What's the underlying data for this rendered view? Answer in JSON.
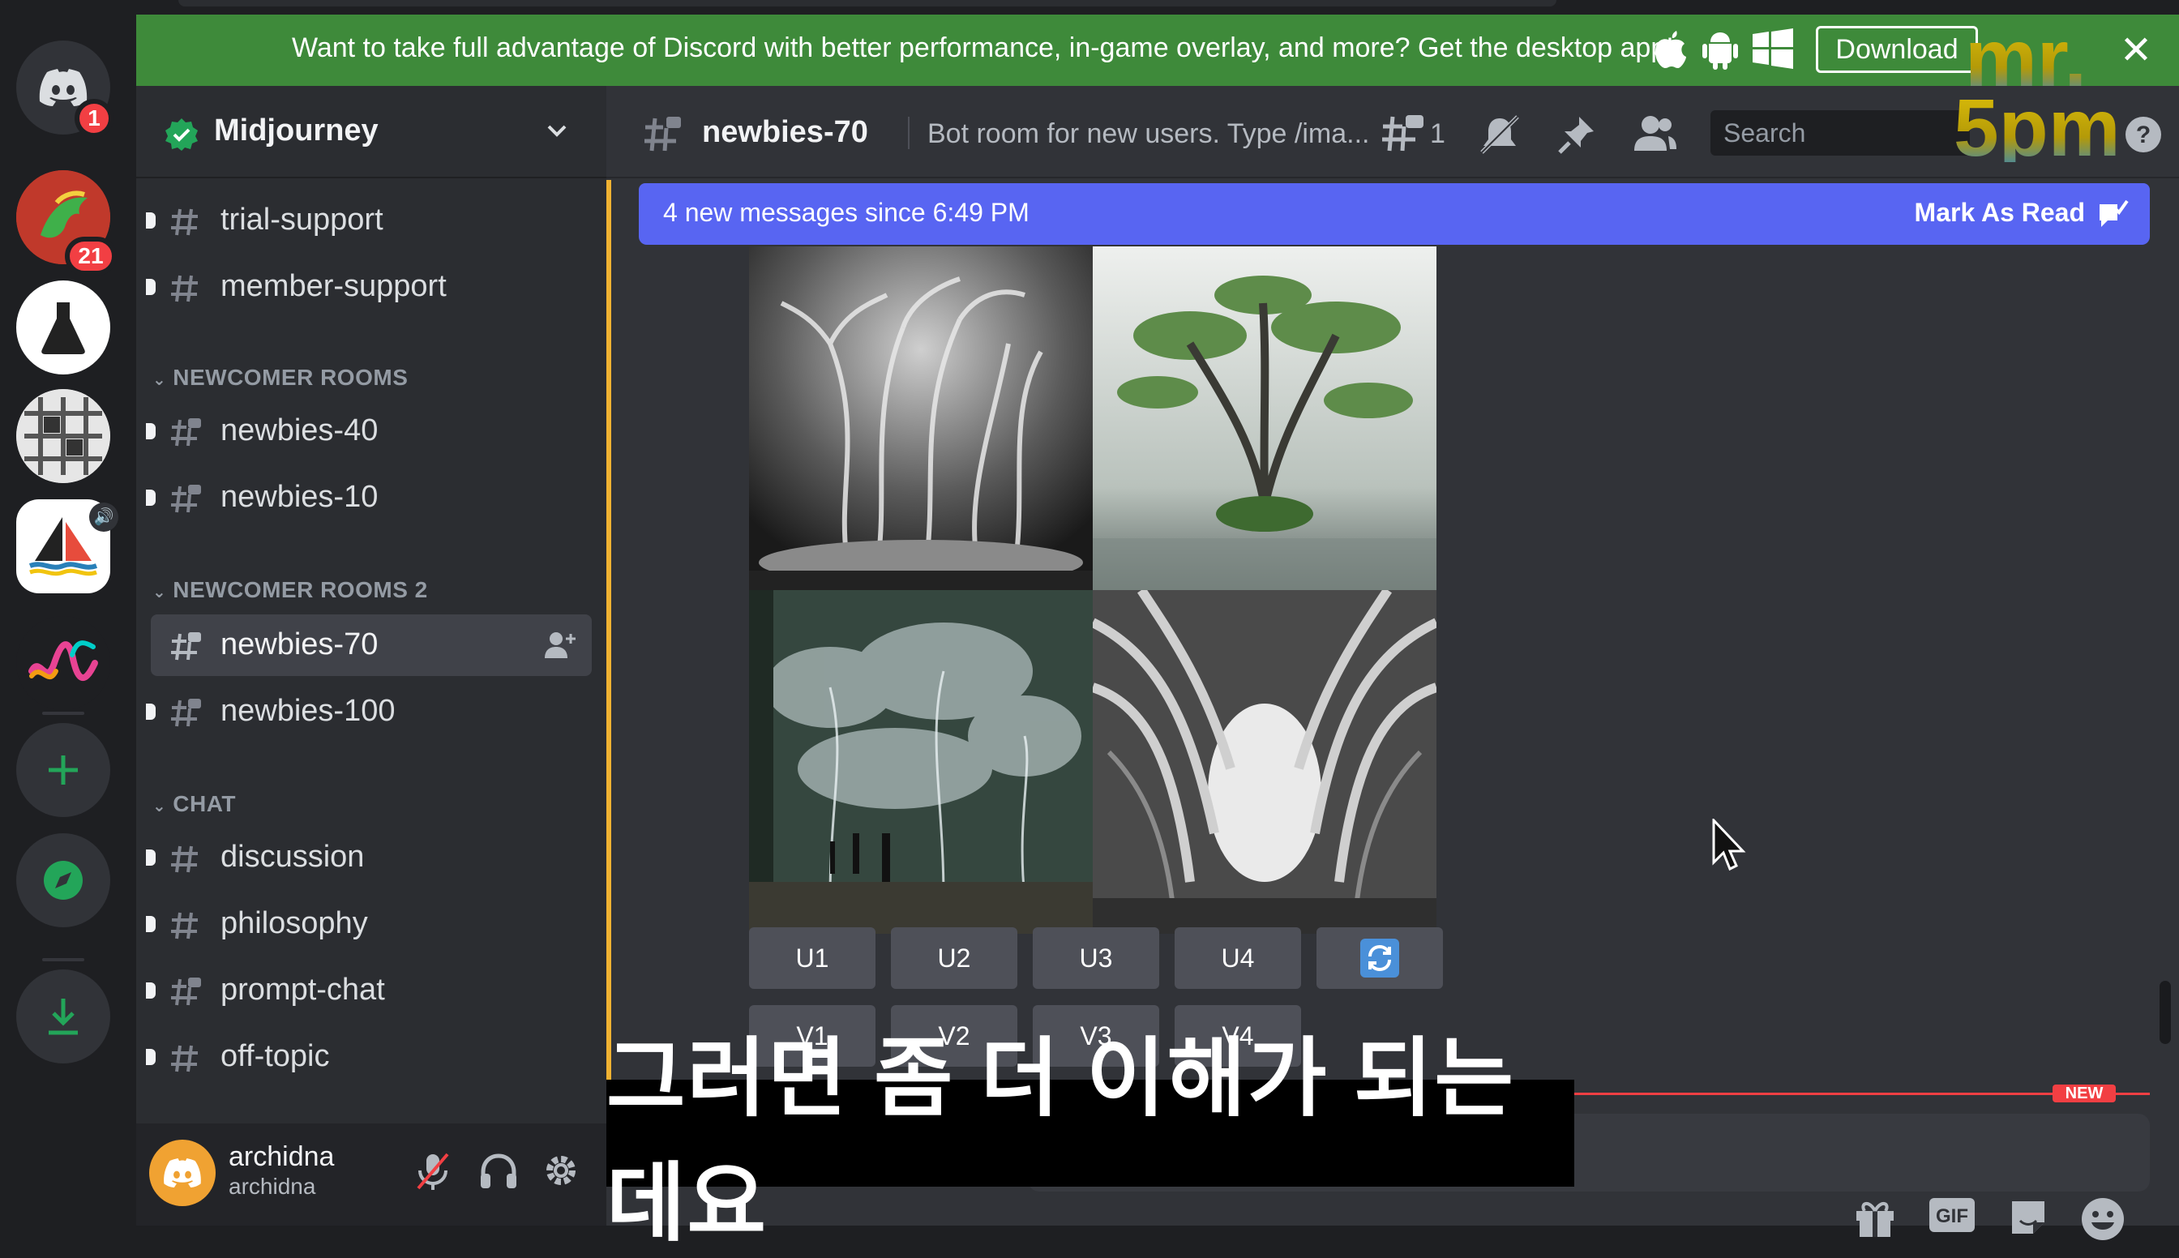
{
  "banner": {
    "text": "Want to take full advantage of Discord with better performance, in-game overlay, and more? Get the desktop app!",
    "download_label": "Download",
    "close_label": "✕"
  },
  "server_rail": {
    "home_badge": "1",
    "server2_badge": "21"
  },
  "guild": {
    "name": "Midjourney"
  },
  "channels": {
    "trial_support": "trial-support",
    "member_support": "member-support",
    "cat_newcomer": "NEWCOMER ROOMS",
    "newbies_40": "newbies-40",
    "newbies_10": "newbies-10",
    "cat_newcomer2": "NEWCOMER ROOMS 2",
    "newbies_70": "newbies-70",
    "newbies_100": "newbies-100",
    "cat_chat": "CHAT",
    "discussion": "discussion",
    "philosophy": "philosophy",
    "prompt_chat": "prompt-chat",
    "off_topic": "off-topic"
  },
  "user": {
    "name": "archidna",
    "tag": "archidna"
  },
  "header": {
    "channel": "newbies-70",
    "topic": "Bot room for new users. Type /ima...",
    "thread_count": "1",
    "search_placeholder": "Search"
  },
  "new_messages": {
    "text": "4 new messages since 6:49 PM",
    "mark_read": "Mark As Read"
  },
  "actions": {
    "u1": "U1",
    "u2": "U2",
    "u3": "U3",
    "u4": "U4",
    "v1": "V1",
    "v2": "V2",
    "v3": "V3",
    "v4": "V4"
  },
  "composer": {
    "new_label": "NEW",
    "gif_label": "GIF"
  },
  "subtitle": "그러면 좀 더 이해가 되는데요",
  "watermark": {
    "line1": "mr.",
    "line2": "5pm"
  },
  "colors": {
    "accent": "#5865f2",
    "banner": "#3e8a3a",
    "sidebar": "#2b2d31",
    "main": "#313338",
    "badge": "#f23f43"
  }
}
